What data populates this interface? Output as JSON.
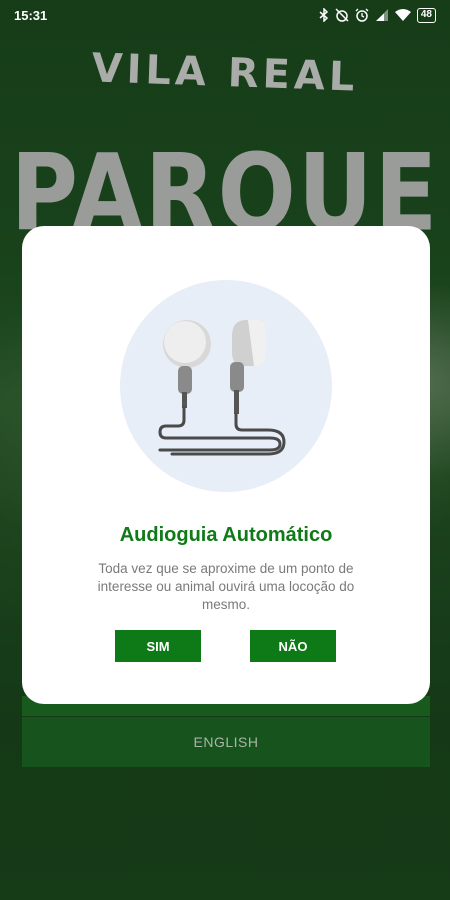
{
  "status_bar": {
    "time": "15:31",
    "battery": "48",
    "icons": [
      "bluetooth-icon",
      "alarm-off-icon",
      "alarm-icon",
      "signal-icon",
      "wifi-icon",
      "battery-icon"
    ]
  },
  "background": {
    "logo_top": "VILA REAL",
    "logo_big": "PARQUE",
    "language_button": "ENGLISH"
  },
  "dialog": {
    "illustration": "earphones-icon",
    "title": "Audioguia Automático",
    "message": "Toda vez que se aproxime de um ponto de interesse ou animal ouvirá uma locoção do mesmo.",
    "yes_label": "SIM",
    "no_label": "NÃO"
  },
  "colors": {
    "accent": "#0e7a17",
    "background": "#1f4a1f",
    "illustration_bg": "#e8eef8"
  }
}
